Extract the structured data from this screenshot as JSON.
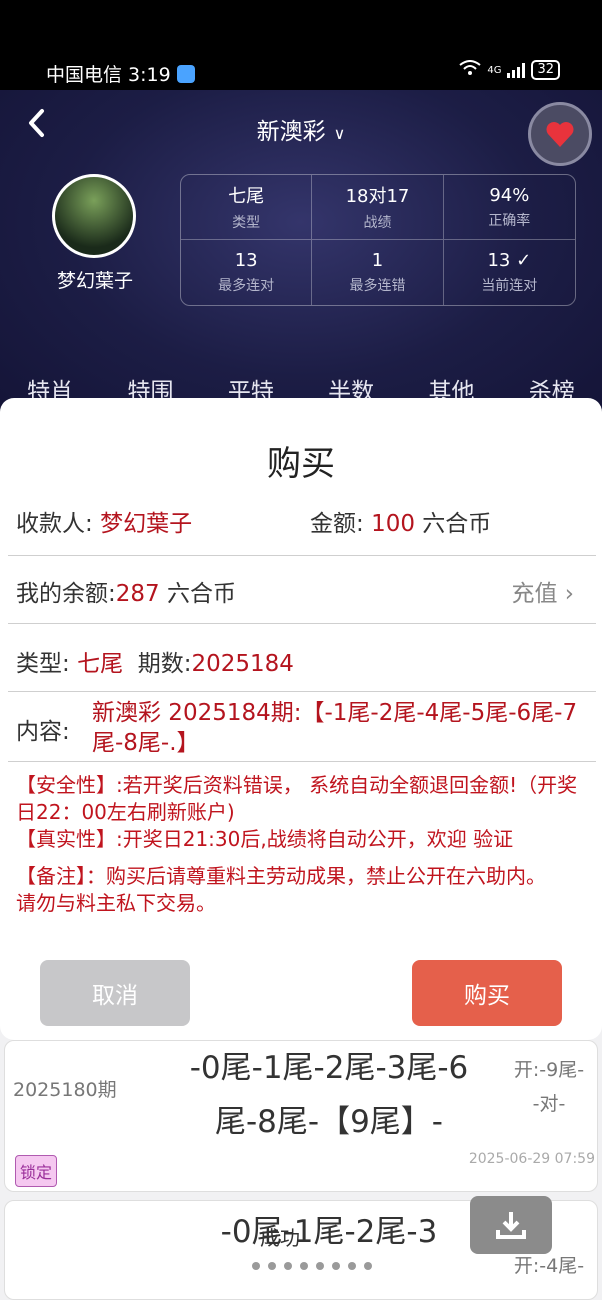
{
  "status_bar": {
    "carrier_time": "中国电信 3:19",
    "network": "4G",
    "battery": "32"
  },
  "header": {
    "title": "新澳彩",
    "username": "梦幻葉子",
    "stats": [
      {
        "value": "七尾",
        "label": "类型"
      },
      {
        "value": "18对17",
        "label": "战绩"
      },
      {
        "value": "94%",
        "label": "正确率"
      },
      {
        "value": "13",
        "label": "最多连对"
      },
      {
        "value": "1",
        "label": "最多连错"
      },
      {
        "value": "13 ✓",
        "label": "当前连对"
      }
    ],
    "tabs": [
      "特肖",
      "特围",
      "平特",
      "半数",
      "其他",
      "杀榜"
    ]
  },
  "modal": {
    "title": "购买",
    "payee_label": "收款人: ",
    "payee": "梦幻葉子",
    "amount_label": "金额: ",
    "amount": "100",
    "amount_unit": " 六合币",
    "balance_label": "我的余额:",
    "balance": "287",
    "balance_unit": " 六合币",
    "recharge": "充值 ›",
    "type_label": "类型: ",
    "type_value": "七尾",
    "period_label": "期数:",
    "period_value": "2025184",
    "content_label": "内容:",
    "content_value": "新澳彩 2025184期:【-1尾-2尾-4尾-5尾-6尾-7尾-8尾-.】",
    "note_safety": "【安全性】:若开奖后资料错误， 系统自动全额退回金额!（开奖日22：00左右刷新账户)",
    "note_truth": "【真实性】:开奖日21:30后,战绩将自动公开，欢迎 验证",
    "note_remark": "【备注】：购买后请尊重料主劳动成果，禁止公开在六助内。",
    "note_private": "请勿与料主私下交易。",
    "cancel": "取消",
    "buy": "购买"
  },
  "list": [
    {
      "period": "2025180期",
      "numbers_line1": "-0尾-1尾-2尾-3尾-6",
      "numbers_line2": "尾-8尾-【9尾】-",
      "open": "开:-9尾-",
      "result": "-对-",
      "date": "2025-06-29 07:59",
      "badge": "锁定"
    },
    {
      "numbers_line1": "-0尾-1尾-2尾-3",
      "open": "开:-4尾-"
    }
  ],
  "toast": "成功"
}
